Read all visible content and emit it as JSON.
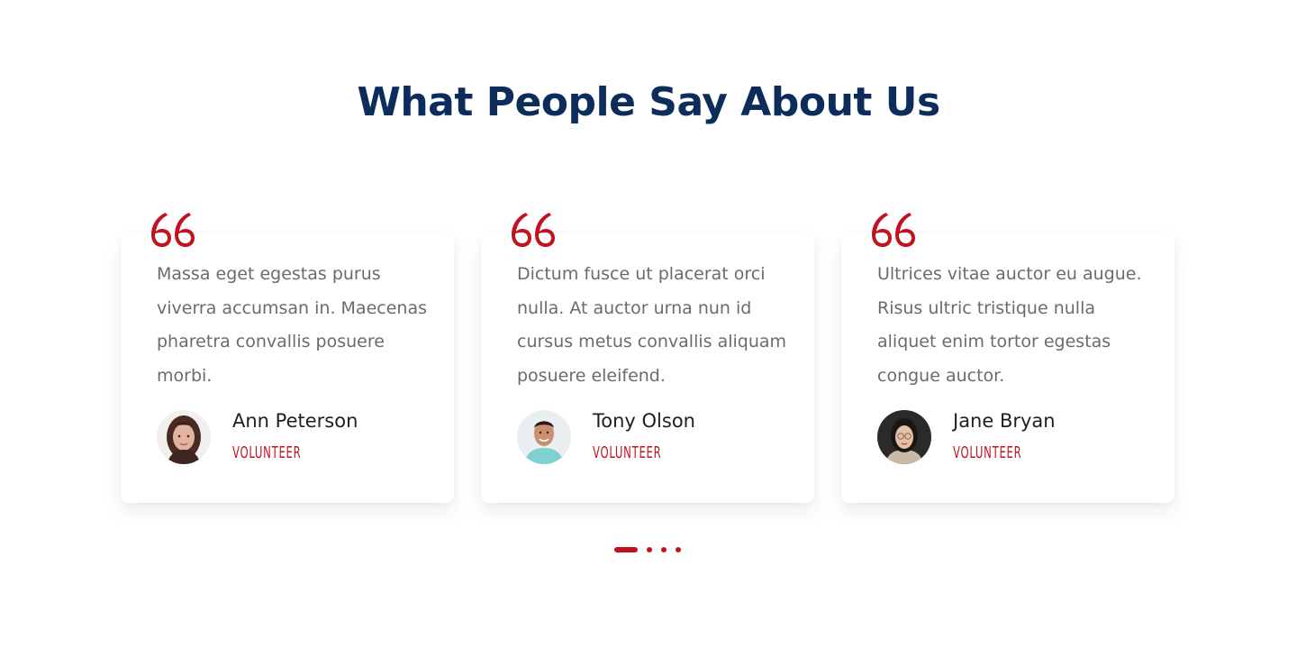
{
  "section": {
    "title": "What People Say About Us"
  },
  "colors": {
    "title": "#0c2d5c",
    "accent": "#c1121f",
    "body_text": "#6b6b6b",
    "name_text": "#1f1f1f"
  },
  "testimonials": [
    {
      "quote_icon": "quote-icon",
      "text": "Massa eget egestas purus viverra accumsan in. Maecenas pharetra convallis posuere morbi.",
      "name": "Ann Peterson",
      "role": "VOLUNTEER",
      "avatar": "avatar-woman-portrait"
    },
    {
      "quote_icon": "quote-icon",
      "text": "Dictum fusce ut placerat orci nulla. At auctor urna nun id cursus metus convallis aliquam posuere eleifend.",
      "name": "Tony Olson",
      "role": "VOLUNTEER",
      "avatar": "avatar-man-portrait"
    },
    {
      "quote_icon": "quote-icon",
      "text": "Ultrices vitae auctor eu augue. Risus ultric tristique nulla aliquet enim tortor egestas congue auctor.",
      "name": "Jane Bryan",
      "role": "VOLUNTEER",
      "avatar": "avatar-woman-glasses-portrait"
    }
  ],
  "pager": {
    "total": 4,
    "active_index": 0
  }
}
